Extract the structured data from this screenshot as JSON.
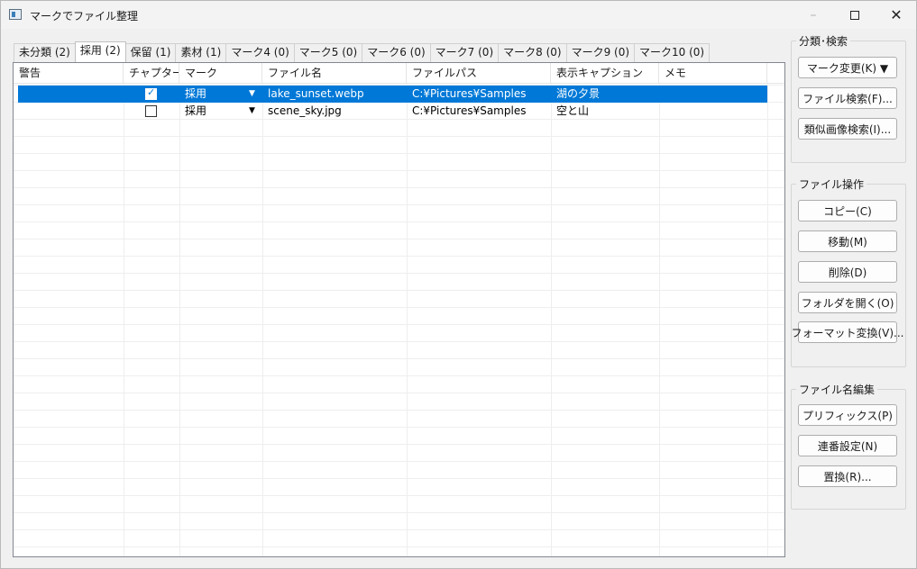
{
  "window": {
    "title": "マークでファイル整理",
    "minimize": "–",
    "close": "✕"
  },
  "tabs": [
    {
      "label": "未分類 (2)"
    },
    {
      "label": "採用 (2)"
    },
    {
      "label": "保留 (1)"
    },
    {
      "label": "素材 (1)"
    },
    {
      "label": "マーク4 (0)"
    },
    {
      "label": "マーク5 (0)"
    },
    {
      "label": "マーク6 (0)"
    },
    {
      "label": "マーク7 (0)"
    },
    {
      "label": "マーク8 (0)"
    },
    {
      "label": "マーク9 (0)"
    },
    {
      "label": "マーク10 (0)"
    }
  ],
  "active_tab_index": 1,
  "table": {
    "columns": [
      "警告",
      "チャプター",
      "マーク",
      "ファイル名",
      "ファイルパス",
      "表示キャプション",
      "メモ"
    ],
    "rows": [
      {
        "warning": "",
        "chapter_checked": true,
        "mark": "採用",
        "filename": "lake_sunset.webp",
        "path": "C:¥Pictures¥Samples",
        "caption": "湖の夕景",
        "memo": "",
        "selected": true
      },
      {
        "warning": "",
        "chapter_checked": false,
        "mark": "採用",
        "filename": "scene_sky.jpg",
        "path": "C:¥Pictures¥Samples",
        "caption": "空と山",
        "memo": "",
        "selected": false
      }
    ]
  },
  "panels": {
    "classify": {
      "title": "分類･検索",
      "buttons": [
        "マーク変更(K) ▼",
        "ファイル検索(F)...",
        "類似画像検索(I)..."
      ]
    },
    "file_ops": {
      "title": "ファイル操作",
      "buttons": [
        "コピー(C)",
        "移動(M)",
        "削除(D)",
        "フォルダを開く(O)",
        "フォーマット変換(V)..."
      ]
    },
    "rename": {
      "title": "ファイル名編集",
      "buttons": [
        "プリフィックス(P)",
        "連番設定(N)",
        "置換(R)..."
      ]
    }
  },
  "colors": {
    "selection": "#0078d7",
    "background": "#f0f0f0"
  }
}
